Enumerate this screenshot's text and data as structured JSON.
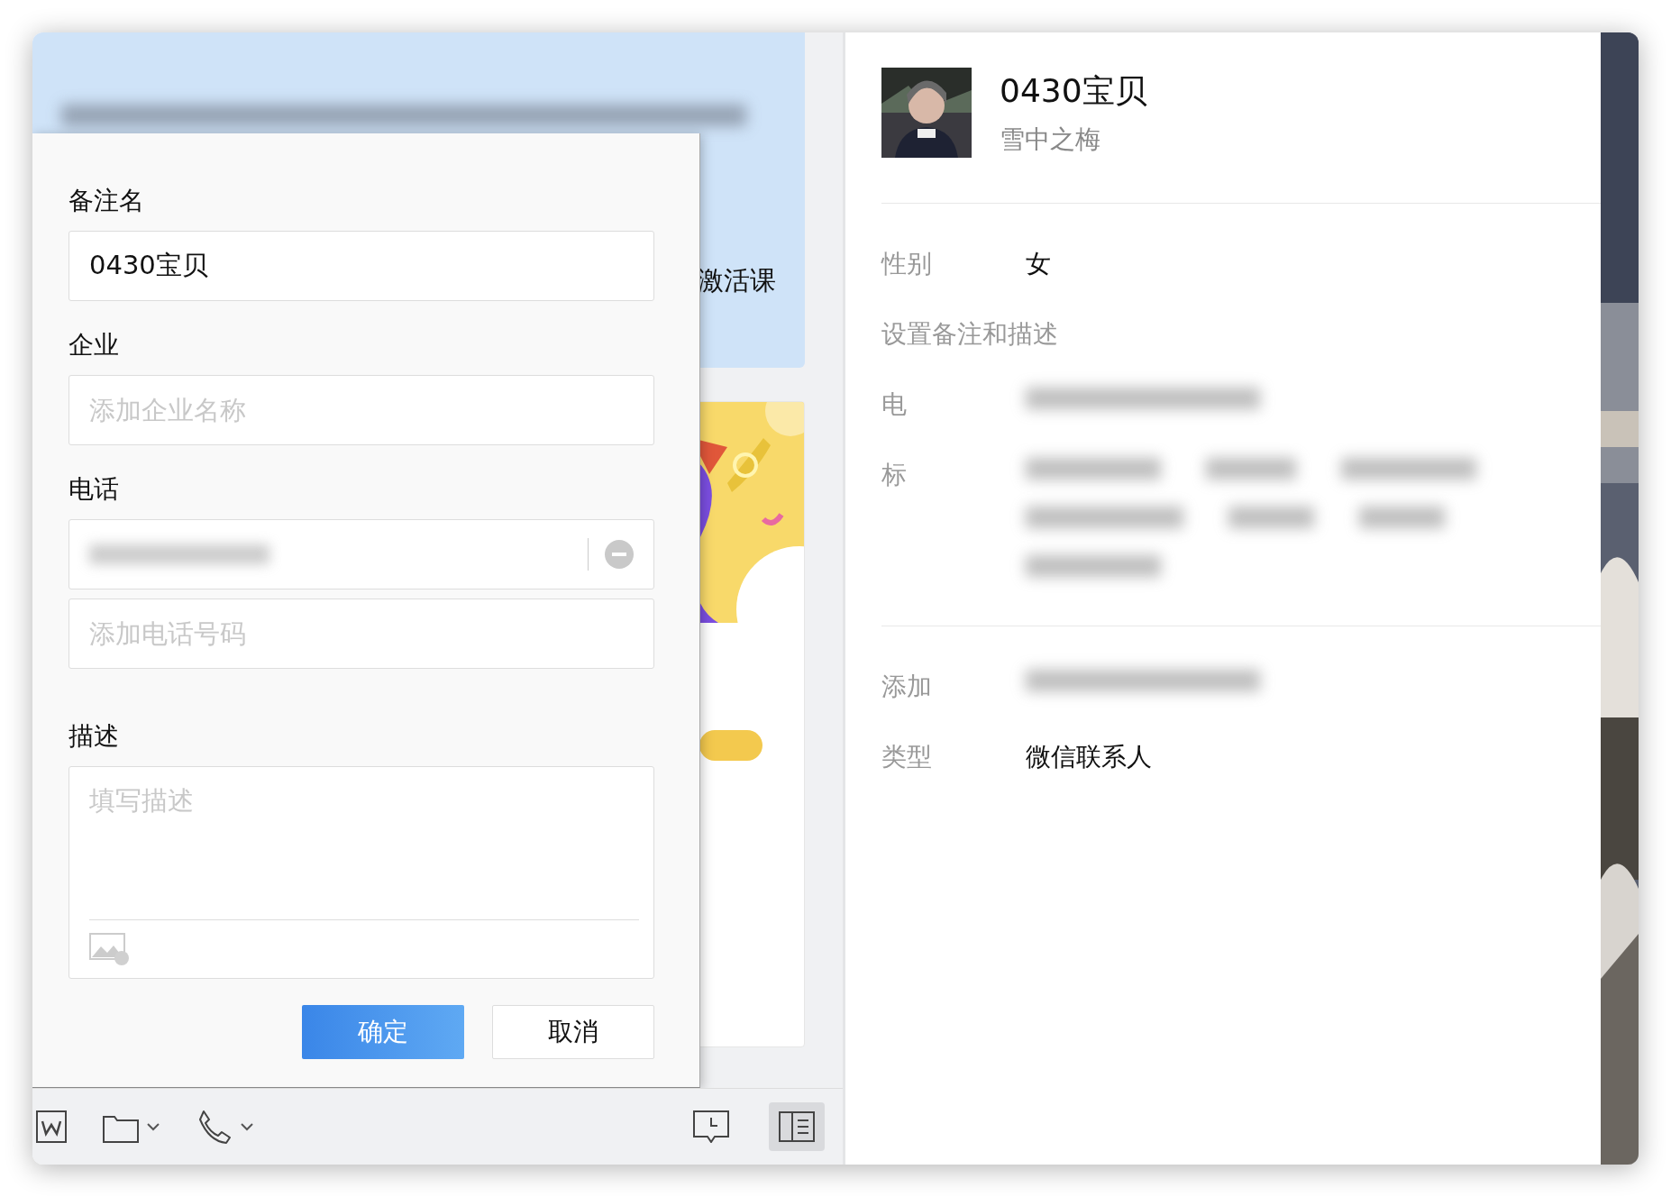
{
  "chat": {
    "bubble_text": "激活课"
  },
  "dialog": {
    "fields": [
      {
        "label": "备注名",
        "inputs": [
          {
            "kind": "text",
            "value": "0430宝贝"
          }
        ]
      },
      {
        "label": "企业",
        "inputs": [
          {
            "kind": "text",
            "placeholder": "添加企业名称"
          }
        ]
      },
      {
        "label": "电话",
        "inputs": [
          {
            "kind": "redacted"
          },
          {
            "kind": "text",
            "placeholder": "添加电话号码"
          }
        ]
      }
    ],
    "description": {
      "label": "描述",
      "placeholder": "填写描述"
    },
    "buttons": [
      {
        "label": "确定",
        "kind": "primary"
      },
      {
        "label": "取消",
        "kind": "secondary"
      }
    ]
  },
  "profile": {
    "name": "0430宝贝",
    "nickname": "雪中之梅",
    "sections": [
      {
        "rows": [
          {
            "kind": "pair",
            "label": "性别",
            "value": "女"
          },
          {
            "kind": "action",
            "label": "设置备注和描述"
          },
          {
            "kind": "redacted_value",
            "label": "电"
          },
          {
            "kind": "redacted_tags",
            "label": "标"
          }
        ]
      },
      {
        "rows": [
          {
            "kind": "redacted_value",
            "label": "添加"
          },
          {
            "kind": "pair",
            "label": "类型",
            "value": "微信联系人"
          }
        ]
      }
    ]
  }
}
